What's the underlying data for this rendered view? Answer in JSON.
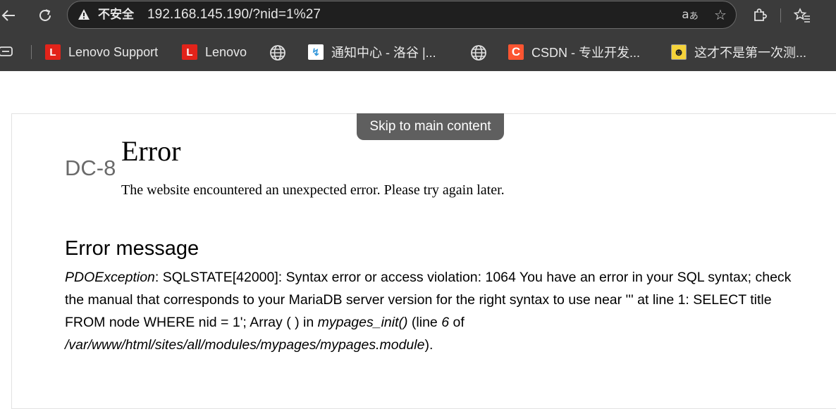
{
  "browser": {
    "security_label": "不安全",
    "url": "192.168.145.190/?nid=1%27",
    "icons": {
      "back": "back-arrow-icon",
      "reload": "reload-icon",
      "warning": "warning-triangle-icon",
      "read_aloud": "read-aloud-icon",
      "favorite": "star-icon",
      "extensions": "puzzle-icon",
      "favorites_list": "favorites-list-icon"
    }
  },
  "bookmarks": [
    {
      "label": "Lenovo Support",
      "icon": "lenovo-icon",
      "color": "#e2231a"
    },
    {
      "label": "Lenovo",
      "icon": "lenovo-icon",
      "color": "#e2231a"
    },
    {
      "label": "",
      "icon": "globe-icon"
    },
    {
      "label": "通知中心 - 洛谷 |...",
      "icon": "luogu-icon",
      "color": "#3498db"
    },
    {
      "label": "",
      "icon": "globe-icon"
    },
    {
      "label": "CSDN - 专业开发...",
      "icon": "csdn-icon",
      "color": "#fc5531"
    },
    {
      "label": "这才不是第一次测...",
      "icon": "smiley-icon",
      "color": "#f5d33a"
    }
  ],
  "page": {
    "skip_link": "Skip to main content",
    "site_name": "DC-8",
    "title": "Error",
    "subtitle": "The website encountered an unexpected error. Please try again later.",
    "message_heading": "Error message",
    "message": {
      "exception": "PDOException",
      "part1": ": SQLSTATE[42000]: Syntax error or access violation: 1064 You have an error in your SQL syntax; check the manual that corresponds to your MariaDB server version for the right syntax to use near ''' at line 1: SELECT title FROM node WHERE nid = 1'; Array ( ) in ",
      "function": "mypages_init()",
      "part2": " (line ",
      "line": "6",
      "part3": " of ",
      "file": "/var/www/html/sites/all/modules/mypages/mypages.module",
      "part4": ")."
    }
  }
}
